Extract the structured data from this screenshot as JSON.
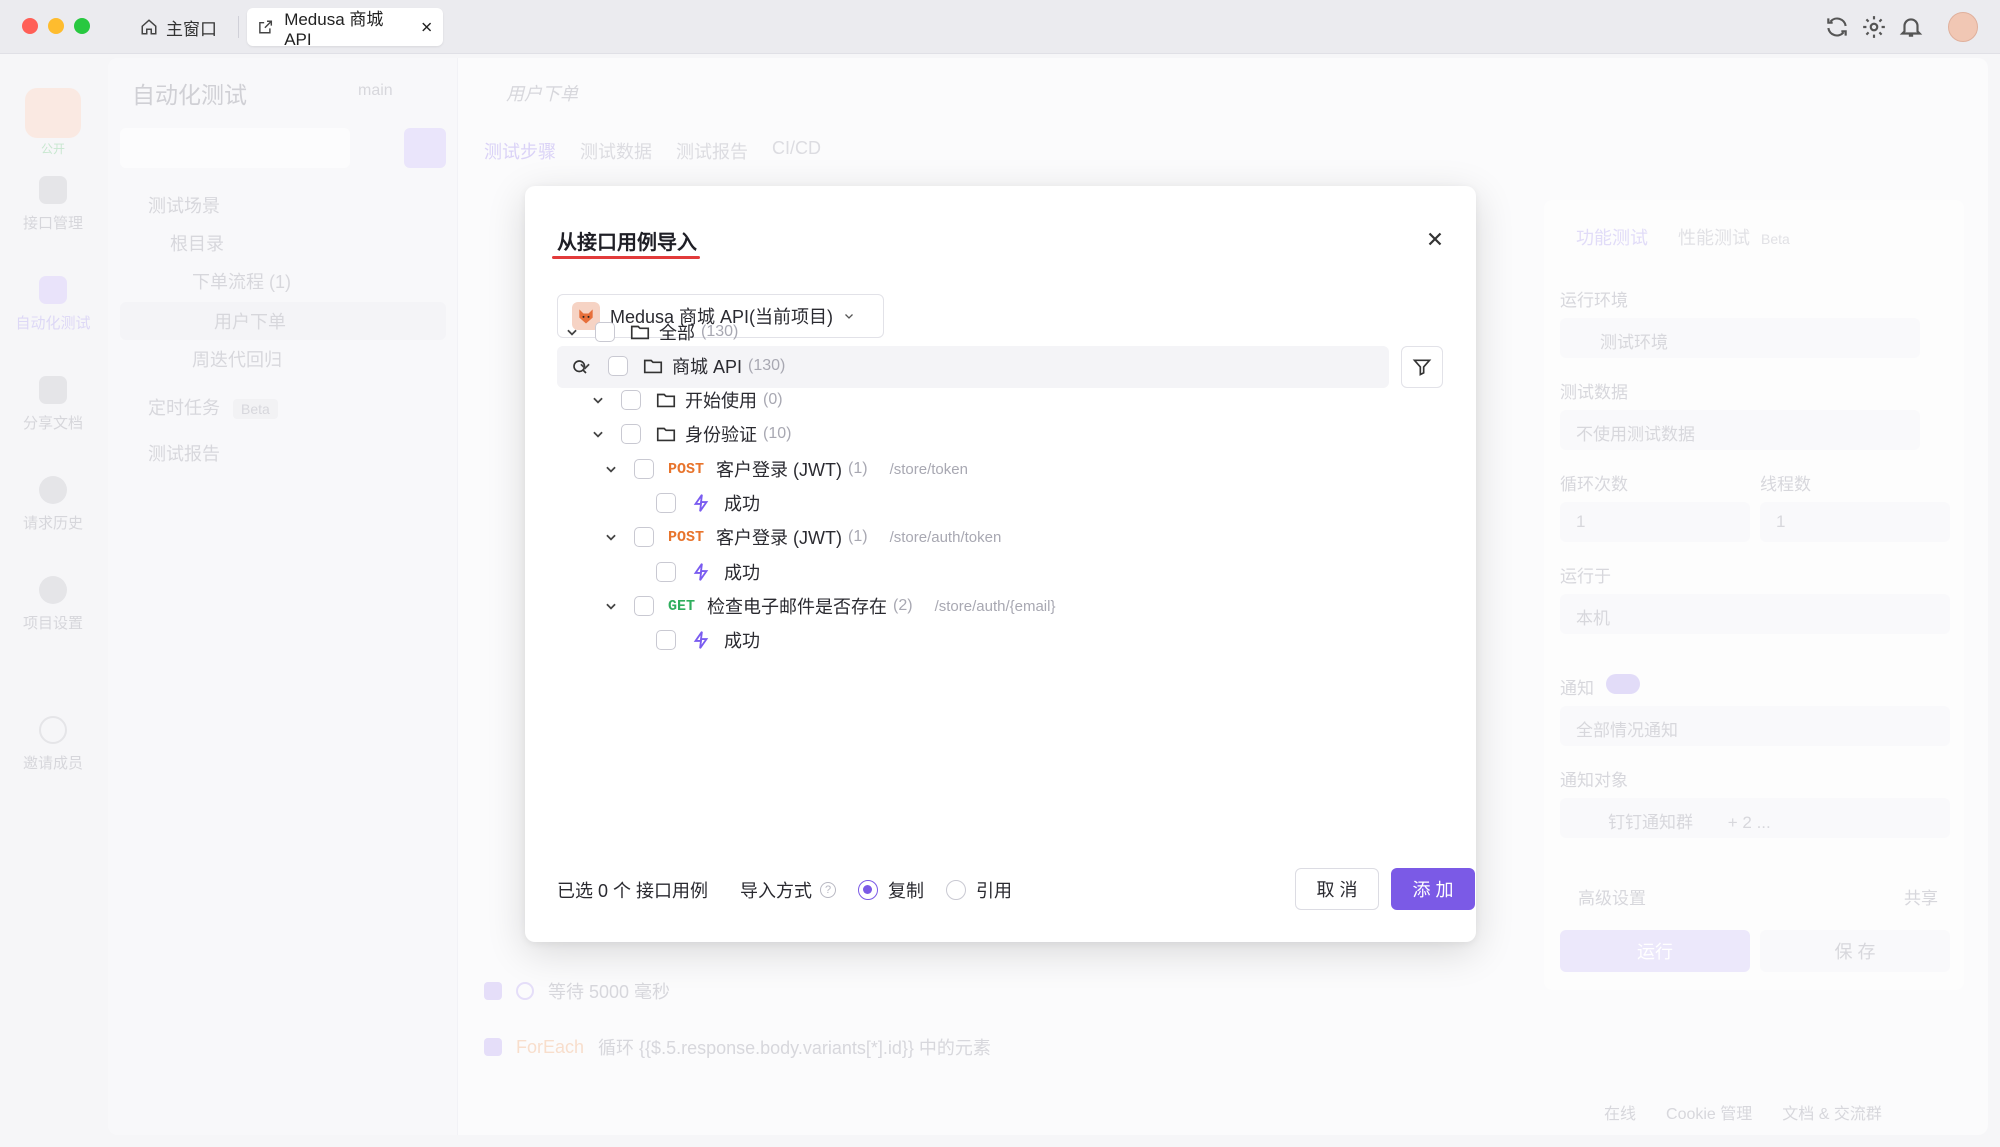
{
  "window": {
    "home_tab": "主窗口",
    "active_tab": "Medusa 商城 API"
  },
  "rail": {
    "public_badge": "公开",
    "items": [
      {
        "label": "接口管理",
        "icon": "api-icon"
      },
      {
        "label": "自动化测试",
        "icon": "automation-icon"
      },
      {
        "label": "分享文档",
        "icon": "docs-icon"
      },
      {
        "label": "请求历史",
        "icon": "history-icon"
      },
      {
        "label": "项目设置",
        "icon": "settings-icon"
      },
      {
        "label": "邀请成员",
        "icon": "invite-icon"
      }
    ]
  },
  "background": {
    "section_title": "自动化测试",
    "branch": "main",
    "scenario_tab": "用户下单",
    "sub_tabs": [
      "测试步骤",
      "测试数据",
      "测试报告",
      "CI/CD"
    ],
    "tree": [
      {
        "label": "测试场景"
      },
      {
        "label": "根目录"
      },
      {
        "label": "下单流程",
        "count": "(1)"
      },
      {
        "label": "用户下单"
      },
      {
        "label": "周迭代回归"
      },
      {
        "label": "定时任务",
        "badge": "Beta"
      },
      {
        "label": "测试报告"
      }
    ],
    "steps": [
      {
        "text": "等待 5000 毫秒"
      },
      {
        "keyword": "ForEach",
        "text": "循环 {{$.5.response.body.variants[*].id}} 中的元素"
      }
    ],
    "right_panel": {
      "tabs": [
        "功能测试",
        "性能测试"
      ],
      "beta": "Beta",
      "run_env_label": "运行环境",
      "run_env_value": "测试环境",
      "test_data_label": "测试数据",
      "test_data_value": "不使用测试数据",
      "loop_label": "循环次数",
      "loop_value": "1",
      "threads_label": "线程数",
      "threads_value": "1",
      "run_on_label": "运行于",
      "run_on_value": "本机",
      "notify_label": "通知",
      "notify_value": "全部情况通知",
      "notify_target_label": "通知对象",
      "notify_target_value": "钉钉通知群",
      "notify_more": "+ 2 ...",
      "advanced": "高级设置",
      "share": "共享",
      "run_btn": "运行",
      "save_btn": "保 存"
    },
    "statusbar": [
      "在线",
      "Cookie 管理",
      "文档 & 交流群"
    ]
  },
  "modal": {
    "title": "从接口用例导入",
    "project": "Medusa 商城 API(当前项目)",
    "search_placeholder": "",
    "tree": [
      {
        "kind": "folder",
        "label": "全部",
        "count": "(130)",
        "level": 0
      },
      {
        "kind": "folder",
        "label": "商城 API",
        "count": "(130)",
        "level": 1
      },
      {
        "kind": "folder",
        "label": "开始使用",
        "count": "(0)",
        "level": 2
      },
      {
        "kind": "folder",
        "label": "身份验证",
        "count": "(10)",
        "level": 2
      },
      {
        "kind": "api",
        "method": "POST",
        "label": "客户登录 (JWT)",
        "count": "(1)",
        "path": "/store/token",
        "level": 3
      },
      {
        "kind": "case",
        "label": "成功",
        "level": 4
      },
      {
        "kind": "api",
        "method": "POST",
        "label": "客户登录 (JWT)",
        "count": "(1)",
        "path": "/store/auth/token",
        "level": 3
      },
      {
        "kind": "case",
        "label": "成功",
        "level": 4
      },
      {
        "kind": "api",
        "method": "GET",
        "label": "检查电子邮件是否存在",
        "count": "(2)",
        "path": "/store/auth/{email}",
        "level": 3
      },
      {
        "kind": "case",
        "label": "成功",
        "level": 4
      }
    ],
    "selected_text": "已选 0 个 接口用例",
    "import_mode_label": "导入方式",
    "mode_copy": "复制",
    "mode_ref": "引用",
    "cancel": "取 消",
    "add": "添 加"
  },
  "colors": {
    "accent": "#7b5ae6",
    "post": "#e8742c",
    "get": "#2fae5d",
    "title_underline": "#e23a3a"
  }
}
